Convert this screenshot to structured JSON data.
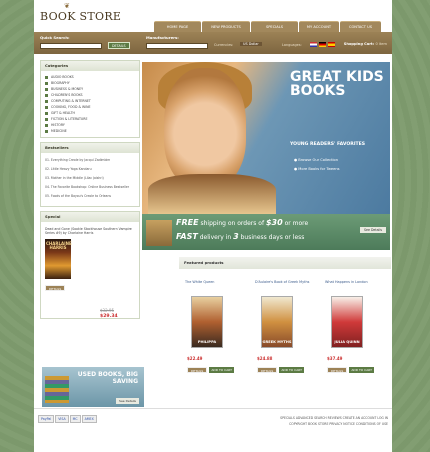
{
  "header": {
    "logo": "BOOK STORE",
    "tabs": [
      "HOME PAGE",
      "NEW PRODUCTS",
      "SPECIALS",
      "MY ACCOUNT",
      "CONTACT US"
    ]
  },
  "search": {
    "label": "Quick Search:",
    "button": "DETAILS"
  },
  "manufacturers": {
    "label": "Manufacturers:"
  },
  "currency": {
    "label": "Currencies:",
    "value": "US Dollar"
  },
  "languages": {
    "label": "Languages:"
  },
  "cart": {
    "label": "Shopping Cart:",
    "value": "0 item"
  },
  "categories": {
    "title": "Categories",
    "items": [
      "AUDIO BOOKS",
      "BIOGRAPHY",
      "BUSINESS & MONEY",
      "CHILDREN'S BOOKS",
      "COMPUTING & INTERNET",
      "COOKING, FOOD & WINE",
      "GIFT & HEALTH",
      "FICTION & LITERATURE",
      "HISTORY",
      "MEDICINE"
    ]
  },
  "bestsellers": {
    "title": "Bestsellers",
    "items": [
      "01. Everything Creole by Jacqui Zadimbim",
      "02. Little Heavy Yoga Kandaru",
      "03. Mother in the Middle (Lilac Jaishri)",
      "04. The Favorite Bookshop: Online Business Bestseller",
      "05. Foods of the Bayou's Creole to Orleans"
    ]
  },
  "special": {
    "title": "Special",
    "text": "Dead and Gone (Sookie Stackhouse Southern Vampire Series #9) by Charlaine Harris",
    "cover": "CHARLAINE HARRIS",
    "price_old": "$32.95",
    "price_new": "$29.34",
    "button": "DETAILS"
  },
  "promo": {
    "text": "USED BOOKS, BIG SAVING",
    "button": "See Details"
  },
  "hero": {
    "headline": "GREAT KIDS BOOKS",
    "subline": "YOUNG READERS' FAVORITES",
    "links": [
      "Browse Our Collection",
      "More Books for Tweens"
    ]
  },
  "shipping": {
    "line1_a": "FREE",
    "line1_b": " shipping on orders of ",
    "line1_c": "$30",
    "line1_d": " or more",
    "line2_a": "FAST",
    "line2_b": " delivery in ",
    "line2_c": "3",
    "line2_d": " business days or less",
    "button": "See Details"
  },
  "featured": {
    "title": "Featured products",
    "products": [
      {
        "title": "The White Queen",
        "cover": "PHILIPPA",
        "price": "$22.49"
      },
      {
        "title": "D'Aulaire's Book of Greek Myths",
        "cover": "GREEK MYTHS",
        "price": "$24.88"
      },
      {
        "title": "What Happens in London",
        "cover": "JULIA QUINN",
        "price": "$37.49"
      }
    ],
    "details": "DETAILS",
    "add": "ADD TO CART"
  },
  "footer": {
    "pay": [
      "PayPal",
      "VISA",
      "MC",
      "AMEX"
    ],
    "links": "SPECIALS  ADVANCED SEARCH  REVIEWS  CREATE AN ACCOUNT  LOG IN",
    "copy": "COPYRIGHT BOOK STORE  PRIVACY NOTICE  CONDITIONS OF USE"
  }
}
